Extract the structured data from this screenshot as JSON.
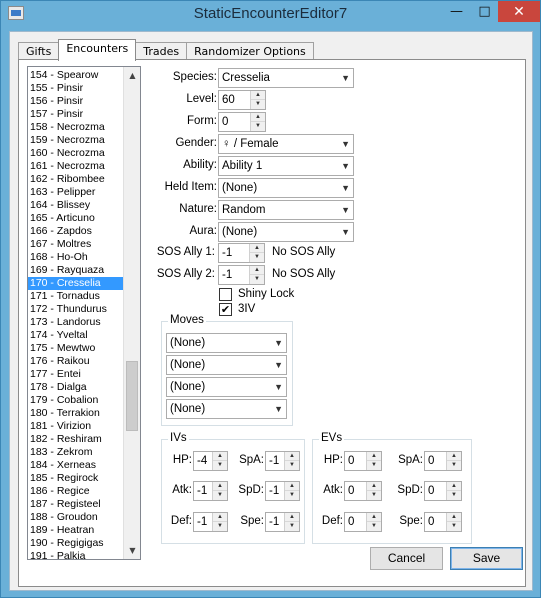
{
  "window": {
    "title": "StaticEncounterEditor7",
    "minimize_glyph": "—",
    "maximize_glyph": "□",
    "close_glyph": "✕",
    "icon": "app-window-icon"
  },
  "tabs": [
    {
      "label": "Gifts",
      "active": false
    },
    {
      "label": "Encounters",
      "active": true
    },
    {
      "label": "Trades",
      "active": false
    },
    {
      "label": "Randomizer Options",
      "active": false
    }
  ],
  "encounter_list": {
    "items": [
      "154 - Spearow",
      "155 - Pinsir",
      "156 - Pinsir",
      "157 - Pinsir",
      "158 - Necrozma",
      "159 - Necrozma",
      "160 - Necrozma",
      "161 - Necrozma",
      "162 - Ribombee",
      "163 - Pelipper",
      "164 - Blissey",
      "165 - Articuno",
      "166 - Zapdos",
      "167 - Moltres",
      "168 - Ho-Oh",
      "169 - Rayquaza",
      "170 - Cresselia",
      "171 - Tornadus",
      "172 - Thundurus",
      "173 - Landorus",
      "174 - Yveltal",
      "175 - Mewtwo",
      "176 - Raikou",
      "177 - Entei",
      "178 - Dialga",
      "179 - Cobalion",
      "180 - Terrakion",
      "181 - Virizion",
      "182 - Reshiram",
      "183 - Zekrom",
      "184 - Xerneas",
      "185 - Regirock",
      "186 - Regice",
      "187 - Registeel",
      "188 - Groudon",
      "189 - Heatran",
      "190 - Regigigas",
      "191 - Palkia"
    ],
    "selected": "170 - Cresselia",
    "scroll_up_glyph": "▲",
    "scroll_down_glyph": "▼"
  },
  "form": {
    "species": {
      "label": "Species:",
      "value": "Cresselia"
    },
    "level": {
      "label": "Level:",
      "value": "60"
    },
    "form": {
      "label": "Form:",
      "value": "0"
    },
    "gender": {
      "label": "Gender:",
      "value": "♀ / Female"
    },
    "ability": {
      "label": "Ability:",
      "value": "Ability 1"
    },
    "held_item": {
      "label": "Held Item:",
      "value": "(None)"
    },
    "nature": {
      "label": "Nature:",
      "value": "Random"
    },
    "aura": {
      "label": "Aura:",
      "value": "(None)"
    },
    "sos_ally_1": {
      "label": "SOS Ally 1:",
      "value": "-1",
      "desc": "No SOS Ally"
    },
    "sos_ally_2": {
      "label": "SOS Ally 2:",
      "value": "-1",
      "desc": "No SOS Ally"
    },
    "shiny_lock": {
      "label": "Shiny Lock",
      "checked": false
    },
    "three_iv": {
      "label": "3IV",
      "checked": true,
      "check_glyph": "✔"
    }
  },
  "moves": {
    "title": "Moves",
    "values": [
      "(None)",
      "(None)",
      "(None)",
      "(None)"
    ]
  },
  "ivs": {
    "title": "IVs",
    "hp": {
      "label": "HP:",
      "value": "-4"
    },
    "atk": {
      "label": "Atk:",
      "value": "-1"
    },
    "def": {
      "label": "Def:",
      "value": "-1"
    },
    "spa": {
      "label": "SpA:",
      "value": "-1"
    },
    "spd": {
      "label": "SpD:",
      "value": "-1"
    },
    "spe": {
      "label": "Spe:",
      "value": "-1"
    }
  },
  "evs": {
    "title": "EVs",
    "hp": {
      "label": "HP:",
      "value": "0"
    },
    "atk": {
      "label": "Atk:",
      "value": "0"
    },
    "def": {
      "label": "Def:",
      "value": "0"
    },
    "spa": {
      "label": "SpA:",
      "value": "0"
    },
    "spd": {
      "label": "SpD:",
      "value": "0"
    },
    "spe": {
      "label": "Spe:",
      "value": "0"
    }
  },
  "buttons": {
    "cancel": "Cancel",
    "save": "Save"
  },
  "glyphs": {
    "dropdown": "▼",
    "spin_up": "▲",
    "spin_down": "▼"
  }
}
